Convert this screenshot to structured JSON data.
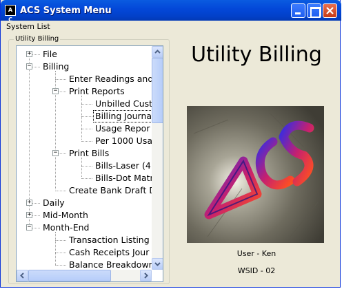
{
  "window": {
    "title": "ACS System Menu",
    "icon": "acs-app-icon",
    "icon_text": "A C S"
  },
  "menubar": {
    "items": [
      "System List"
    ]
  },
  "group": {
    "label": "Utility Billing"
  },
  "tree": [
    {
      "label": "File",
      "expander": "+"
    },
    {
      "label": "Billing",
      "expander": "−"
    },
    {
      "label": "Enter Readings and"
    },
    {
      "label": "Print Reports",
      "expander": "−"
    },
    {
      "label": "Unbilled Cust"
    },
    {
      "label": "Billing Journal",
      "selected": true
    },
    {
      "label": "Usage Repor"
    },
    {
      "label": "Per 1000 Usa"
    },
    {
      "label": "Print Bills",
      "expander": "−"
    },
    {
      "label": "Bills-Laser (4"
    },
    {
      "label": "Bills-Dot Matr"
    },
    {
      "label": "Create Bank Draft D"
    },
    {
      "label": "Daily",
      "expander": "+"
    },
    {
      "label": "Mid-Month",
      "expander": "+"
    },
    {
      "label": "Month-End",
      "expander": "−"
    },
    {
      "label": "Transaction Listing"
    },
    {
      "label": "Cash Receipts Jour"
    },
    {
      "label": "Balance Breakdowr"
    }
  ],
  "right": {
    "title": "Utility Billing",
    "logo_text": "ACS",
    "user": "User - Ken",
    "wsid": "WSID - 02"
  },
  "colors": {
    "titlebar": "#0347d8",
    "accent": "#e8334a",
    "panel": "#ece9d8"
  }
}
